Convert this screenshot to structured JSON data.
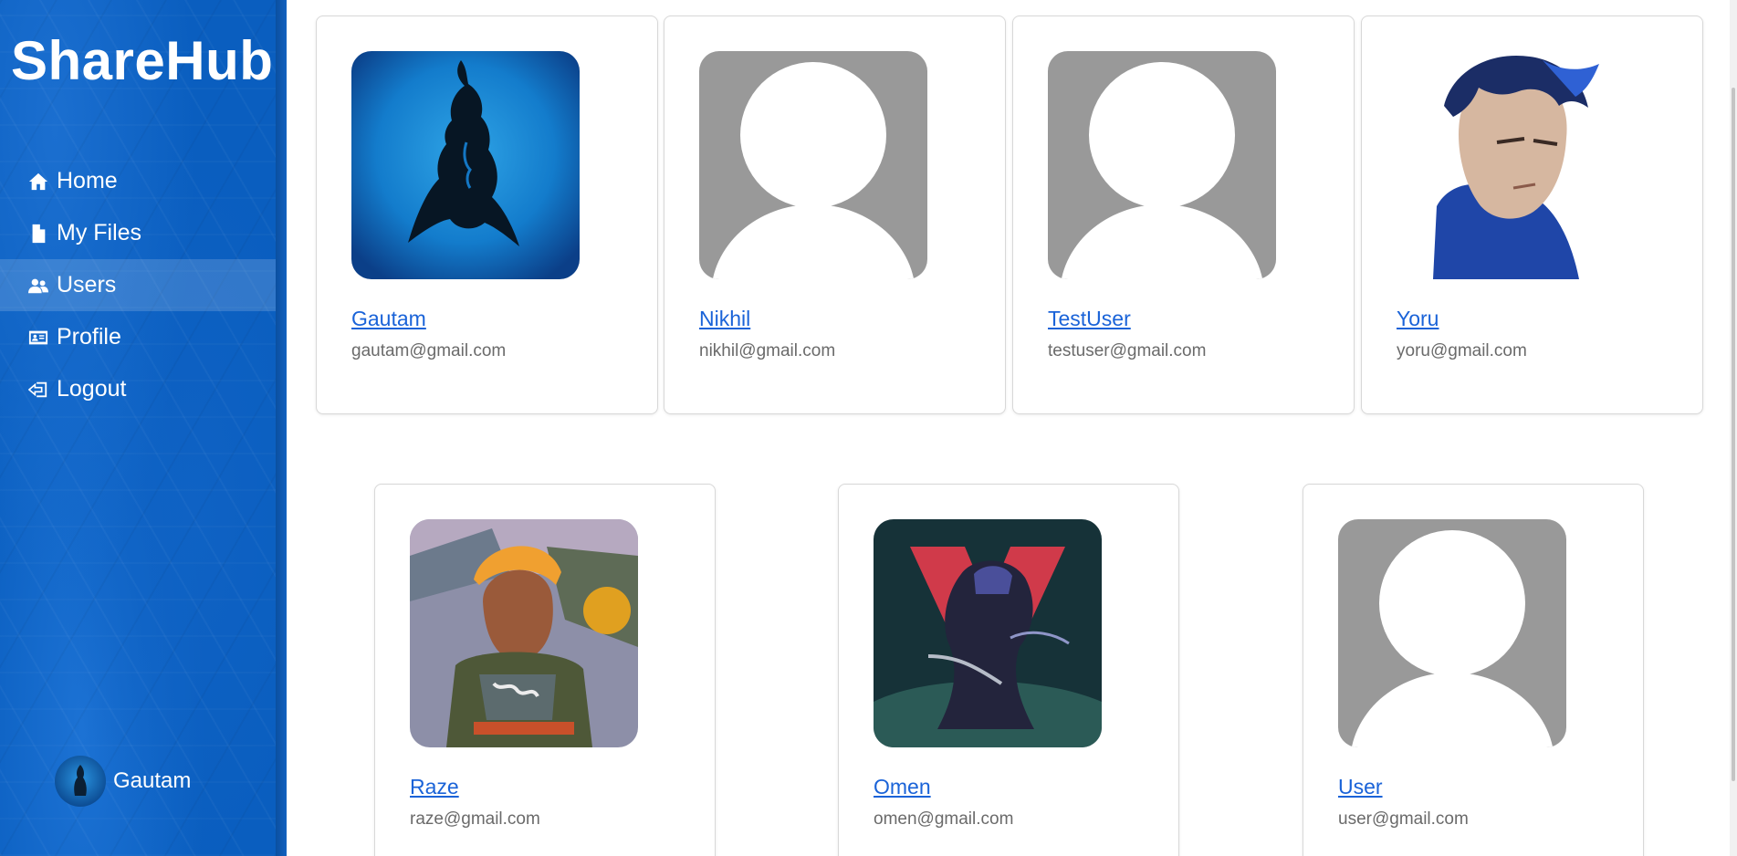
{
  "app": {
    "brand": "ShareHub"
  },
  "sidebar": {
    "items": [
      {
        "label": "Home",
        "icon": "home-icon",
        "active": false
      },
      {
        "label": "My Files",
        "icon": "file-icon",
        "active": false
      },
      {
        "label": "Users",
        "icon": "users-icon",
        "active": true
      },
      {
        "label": "Profile",
        "icon": "id-card-icon",
        "active": false
      },
      {
        "label": "Logout",
        "icon": "logout-icon",
        "active": false
      }
    ],
    "current_user": {
      "name": "Gautam"
    }
  },
  "users": [
    {
      "name": "Gautam",
      "email": "gautam@gmail.com",
      "avatar": "shiva-artwork"
    },
    {
      "name": "Nikhil",
      "email": "nikhil@gmail.com",
      "avatar": "default-avatar"
    },
    {
      "name": "TestUser",
      "email": "testuser@gmail.com",
      "avatar": "default-avatar"
    },
    {
      "name": "Yoru",
      "email": "yoru@gmail.com",
      "avatar": "yoru-portrait"
    },
    {
      "name": "Raze",
      "email": "raze@gmail.com",
      "avatar": "raze-portrait"
    },
    {
      "name": "Omen",
      "email": "omen@gmail.com",
      "avatar": "omen-artwork"
    },
    {
      "name": "User",
      "email": "user@gmail.com",
      "avatar": "default-avatar"
    }
  ],
  "colors": {
    "sidebar": "#0a5ebf",
    "link": "#1a63d8",
    "email": "#6a6a6a",
    "placeholder_bg": "#999999"
  }
}
